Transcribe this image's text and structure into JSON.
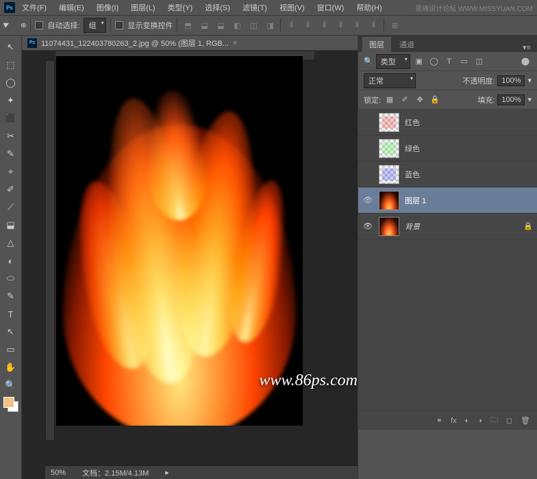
{
  "menubar": {
    "items": [
      "文件(F)",
      "编辑(E)",
      "图像(I)",
      "图层(L)",
      "类型(Y)",
      "选择(S)",
      "滤镜(T)",
      "视图(V)",
      "窗口(W)",
      "帮助(H)"
    ],
    "watermark": "思缘设计论坛  WWW.MISSYUAN.COM"
  },
  "optionsbar": {
    "auto_select_label": "自动选择:",
    "scope": "组",
    "show_transform": "显示变换控件"
  },
  "document": {
    "tab_title": "11074431_122403780263_2.jpg @ 50% (图层 1, RGB...",
    "zoom": "50%",
    "doc_info": "文档：2.15M/4.13M",
    "url": "www.86ps.com"
  },
  "layers_panel": {
    "tabs": {
      "layers": "图层",
      "channels": "通道"
    },
    "filter_type": "类型",
    "blend_mode": "正常",
    "opacity_label": "不透明度:",
    "opacity": "100%",
    "lock_label": "锁定:",
    "fill_label": "填充:",
    "fill": "100%",
    "layers": [
      {
        "name": "红色",
        "visible": false,
        "thumb": "red"
      },
      {
        "name": "绿色",
        "visible": false,
        "thumb": "green"
      },
      {
        "name": "蓝色",
        "visible": false,
        "thumb": "blue"
      },
      {
        "name": "图层 1",
        "visible": true,
        "thumb": "flame",
        "selected": true
      },
      {
        "name": "背景",
        "visible": true,
        "thumb": "flame",
        "locked": true,
        "italic": true
      }
    ]
  },
  "tools": [
    "↖",
    "⬚",
    "◯",
    "✦",
    "⬛",
    "✂",
    "✎",
    "⌖",
    "✐",
    "⟋",
    "⬓",
    "△",
    "◐",
    "⬭",
    "✎",
    "T",
    "↖",
    "▭",
    "✋",
    "🔍"
  ],
  "icons": {
    "search": "🔍",
    "image": "▣",
    "circle": "◯",
    "text": "T",
    "rect": "▭",
    "link": "⚭",
    "fx": "fx",
    "mask": "◐",
    "adjust": "◑",
    "folder": "🗀",
    "new": "◻",
    "trash": "🗑",
    "lock": "🔒",
    "eye": "👁"
  }
}
